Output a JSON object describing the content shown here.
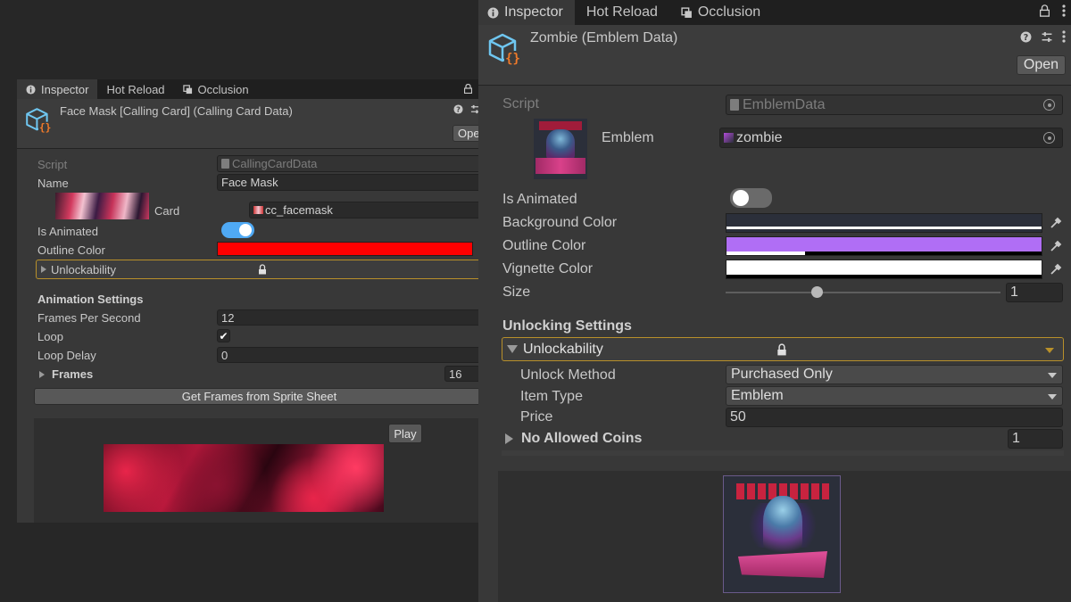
{
  "left_inspector": {
    "tabs": [
      {
        "label": "Inspector",
        "icon": "info-icon"
      },
      {
        "label": "Hot Reload",
        "icon": ""
      },
      {
        "label": "Occlusion",
        "icon": "occlusion-icon"
      }
    ],
    "title": "Face Mask [Calling Card] (Calling Card Data)",
    "open_label": "Ope",
    "script_label": "Script",
    "script_value": "CallingCardData",
    "name_label": "Name",
    "name_value": "Face Mask",
    "card_label": "Card",
    "card_value": "cc_facemask",
    "is_animated_label": "Is Animated",
    "is_animated": true,
    "outline_color_label": "Outline Color",
    "outline_color": "#ff0000",
    "unlockability_label": "Unlockability",
    "animation_settings_label": "Animation Settings",
    "fps_label": "Frames Per Second",
    "fps_value": "12",
    "loop_label": "Loop",
    "loop_checked": true,
    "loop_delay_label": "Loop Delay",
    "loop_delay_value": "0",
    "frames_label": "Frames",
    "frames_count": "16",
    "get_frames_label": "Get Frames from Sprite Sheet",
    "play_label": "Play"
  },
  "right_inspector": {
    "tabs": [
      {
        "label": "Inspector",
        "icon": "info-icon"
      },
      {
        "label": "Hot Reload",
        "icon": ""
      },
      {
        "label": "Occlusion",
        "icon": "occlusion-icon"
      }
    ],
    "title": "Zombie (Emblem Data)",
    "open_label": "Open",
    "script_label": "Script",
    "script_value": "EmblemData",
    "emblem_label": "Emblem",
    "emblem_value": "zombie",
    "is_animated_label": "Is Animated",
    "is_animated": false,
    "background_color_label": "Background Color",
    "background_color": "#2b2f3a",
    "outline_color_label": "Outline Color",
    "outline_color": "#b06ef5",
    "vignette_color_label": "Vignette Color",
    "vignette_color": "#ffffff",
    "size_label": "Size",
    "size_value": "1",
    "size_slider": 0.33,
    "unlocking_settings_label": "Unlocking Settings",
    "unlockability_label": "Unlockability",
    "unlock_method_label": "Unlock Method",
    "unlock_method_value": "Purchased Only",
    "item_type_label": "Item Type",
    "item_type_value": "Emblem",
    "price_label": "Price",
    "price_value": "50",
    "no_allowed_coins_label": "No Allowed Coins",
    "no_allowed_coins_value": "1"
  },
  "colors": {
    "panel": "#383838",
    "toggle_on": "#4fa9f4",
    "foldout_border": "#b8902a",
    "accent_orange": "#f07a2a",
    "icon_blue": "#6fc6f0"
  }
}
